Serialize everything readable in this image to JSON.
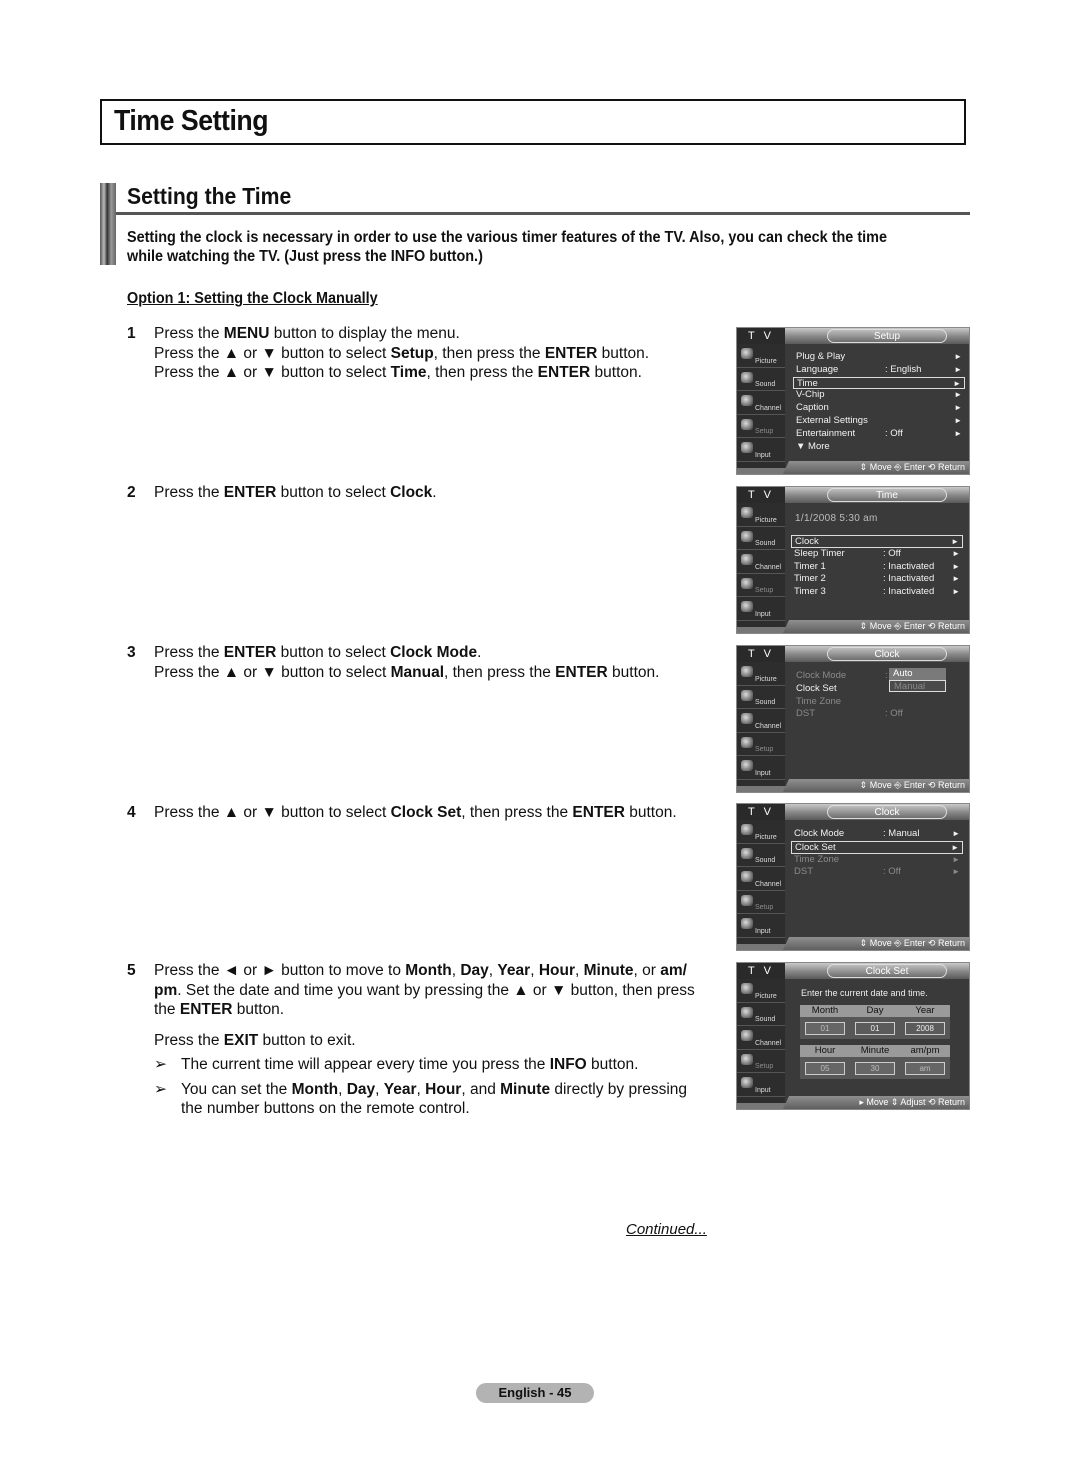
{
  "page_title": "Time Setting",
  "section_title": "Setting the Time",
  "intro": [
    "Setting the clock is necessary in order to use the various timer features of the TV. Also, you can check the time",
    "while watching the TV. (Just press the INFO button.)"
  ],
  "option_heading": "Option 1: Setting the Clock Manually",
  "steps": {
    "s1": {
      "num": "1",
      "l1a": "Press the ",
      "l1b": "MENU",
      "l1c": " button to display the menu.",
      "l2a": "Press the ▲ or ▼ button to select ",
      "l2b": "Setup",
      "l2c": ", then press the ",
      "l2d": "ENTER",
      "l2e": " button.",
      "l3a": "Press the ▲ or ▼ button to select ",
      "l3b": "Time",
      "l3c": ", then press the ",
      "l3d": "ENTER",
      "l3e": " button."
    },
    "s2": {
      "num": "2",
      "a": "Press the ",
      "b": "ENTER",
      "c": " button to select ",
      "d": "Clock",
      "e": "."
    },
    "s3": {
      "num": "3",
      "l1a": "Press the ",
      "l1b": "ENTER",
      "l1c": " button to select ",
      "l1d": "Clock Mode",
      "l1e": ".",
      "l2a": "Press the ▲ or ▼ button to select ",
      "l2b": "Manual",
      "l2c": ", then press the ",
      "l2d": "ENTER",
      "l2e": " button."
    },
    "s4": {
      "num": "4",
      "a": "Press the ▲ or ▼ button to select ",
      "b": "Clock Set",
      "c": ", then press the ",
      "d": "ENTER",
      "e": " button."
    },
    "s5": {
      "num": "5",
      "a": "Press the ◄ or ► button to move to ",
      "b": "Month",
      "c": ", ",
      "d": "Day",
      "e": ", ",
      "f": "Year",
      "g": ", ",
      "h": "Hour",
      "i": ", ",
      "j": "Minute",
      "k": ", or ",
      "l": "am/ pm",
      "m": ". Set the date and time you want by pressing the ▲ or ▼ button, then press the ",
      "n": "ENTER",
      "o": " button.",
      "exit_a": "Press the ",
      "exit_b": "EXIT",
      "exit_c": " button to exit.",
      "note_arrow": "➢",
      "n1a": "The current time will appear every time you press the ",
      "n1b": "INFO",
      "n1c": " button.",
      "n2a": "You can set the ",
      "n2b": "Month",
      "n2c": ", ",
      "n2d": "Day",
      "n2e": ", ",
      "n2f": "Year",
      "n2g": ", ",
      "n2h": "Hour",
      "n2i": ", and ",
      "n2j": "Minute",
      "n2k": " directly by pressing the number buttons on the remote control."
    }
  },
  "osd_common": {
    "tv_label": "T V",
    "sidebar": [
      "Picture",
      "Sound",
      "Channel",
      "Setup",
      "Input"
    ],
    "footer_standard": "⇕ Move   ⎆ Enter   ⟲ Return",
    "footer_clockset": "▸ Move   ⇕ Adjust   ⟲ Return"
  },
  "osd1": {
    "title": "Setup",
    "rows": [
      {
        "label": "Plug & Play",
        "value": "",
        "arrow": "►"
      },
      {
        "label": "Language",
        "value": ": English",
        "arrow": "►"
      },
      {
        "label": "Time",
        "value": "",
        "arrow": "►"
      },
      {
        "label": "V-Chip",
        "value": "",
        "arrow": "►"
      },
      {
        "label": "Caption",
        "value": "",
        "arrow": "►"
      },
      {
        "label": "External Settings",
        "value": "",
        "arrow": "►"
      },
      {
        "label": "Entertainment",
        "value": ": Off",
        "arrow": "►"
      },
      {
        "label": "▼ More",
        "value": "",
        "arrow": ""
      }
    ]
  },
  "osd2": {
    "title": "Time",
    "datetime": "1/1/2008   5:30 am",
    "rows": [
      {
        "label": "Clock",
        "value": "",
        "arrow": "►"
      },
      {
        "label": "Sleep Timer",
        "value": ": Off",
        "arrow": "►"
      },
      {
        "label": "Timer 1",
        "value": ": Inactivated",
        "arrow": "►"
      },
      {
        "label": "Timer 2",
        "value": ": Inactivated",
        "arrow": "►"
      },
      {
        "label": "Timer 3",
        "value": ": Inactivated",
        "arrow": "►"
      }
    ]
  },
  "osd3": {
    "title": "Clock",
    "rows": [
      {
        "label": "Clock Mode",
        "value": ":"
      },
      {
        "label": "Clock Set",
        "value": ""
      },
      {
        "label": "Time Zone",
        "value": ""
      },
      {
        "label": "DST",
        "value": ": Off"
      }
    ],
    "dropdown": [
      "Auto",
      "Manual"
    ]
  },
  "osd4": {
    "title": "Clock",
    "rows": [
      {
        "label": "Clock Mode",
        "value": ": Manual",
        "arrow": "►"
      },
      {
        "label": "Clock Set",
        "value": "",
        "arrow": "►"
      },
      {
        "label": "Time Zone",
        "value": "",
        "arrow": "►"
      },
      {
        "label": "DST",
        "value": ": Off",
        "arrow": "►"
      }
    ]
  },
  "osd5": {
    "title": "Clock Set",
    "message": "Enter the current date and time.",
    "date_headers": [
      "Month",
      "Day",
      "Year"
    ],
    "date_values": [
      "01",
      "01",
      "2008"
    ],
    "time_headers": [
      "Hour",
      "Minute",
      "am/pm"
    ],
    "time_values": [
      "05",
      "30",
      "am"
    ]
  },
  "continued": "Continued...",
  "page_number": "English - 45"
}
